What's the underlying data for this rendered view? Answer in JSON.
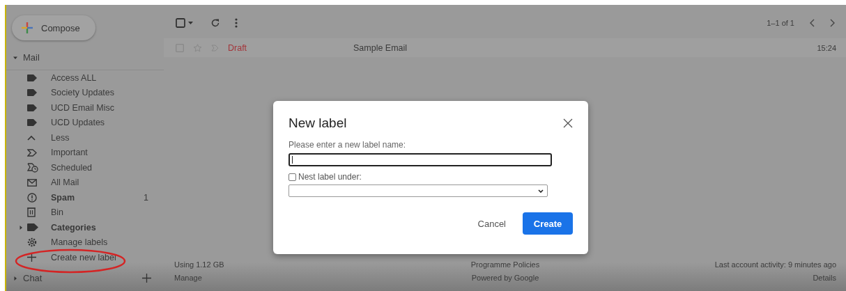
{
  "compose": {
    "label": "Compose"
  },
  "mail_section": {
    "label": "Mail",
    "expanded": true
  },
  "sidebar_items": [
    {
      "kind": "label",
      "label": "Access ALL",
      "unread": false
    },
    {
      "kind": "label",
      "label": "Society Updates",
      "unread": false
    },
    {
      "kind": "label",
      "label": "UCD Email Misc",
      "unread": false
    },
    {
      "kind": "label",
      "label": "UCD Updates",
      "unread": false
    },
    {
      "kind": "less",
      "label": "Less",
      "unread": false
    },
    {
      "kind": "important",
      "label": "Important",
      "unread": false
    },
    {
      "kind": "scheduled",
      "label": "Scheduled",
      "unread": false
    },
    {
      "kind": "allmail",
      "label": "All Mail",
      "unread": false
    },
    {
      "kind": "spam",
      "label": "Spam",
      "unread": true,
      "count": "1"
    },
    {
      "kind": "bin",
      "label": "Bin",
      "unread": false
    },
    {
      "kind": "categories",
      "label": "Categories",
      "unread": true
    },
    {
      "kind": "manage",
      "label": "Manage labels",
      "unread": false
    },
    {
      "kind": "create",
      "label": "Create new label",
      "unread": false
    }
  ],
  "chat": {
    "label": "Chat",
    "expanded": false
  },
  "pager": "1–1 of 1",
  "emails": [
    {
      "status": "Draft",
      "subject": "Sample Email",
      "time": "15:24",
      "selected": false,
      "starred": false
    }
  ],
  "footer": {
    "storage": "Using 1.12 GB",
    "manage": "Manage",
    "policies": "Programme Policies",
    "powered": "Powered by Google",
    "activity": "Last account activity: 9 minutes ago",
    "details": "Details"
  },
  "dialog": {
    "title": "New label",
    "prompt": "Please enter a new label name:",
    "nest": {
      "label": "Nest label under:",
      "checked": false
    },
    "cancel": "Cancel",
    "create": "Create"
  }
}
